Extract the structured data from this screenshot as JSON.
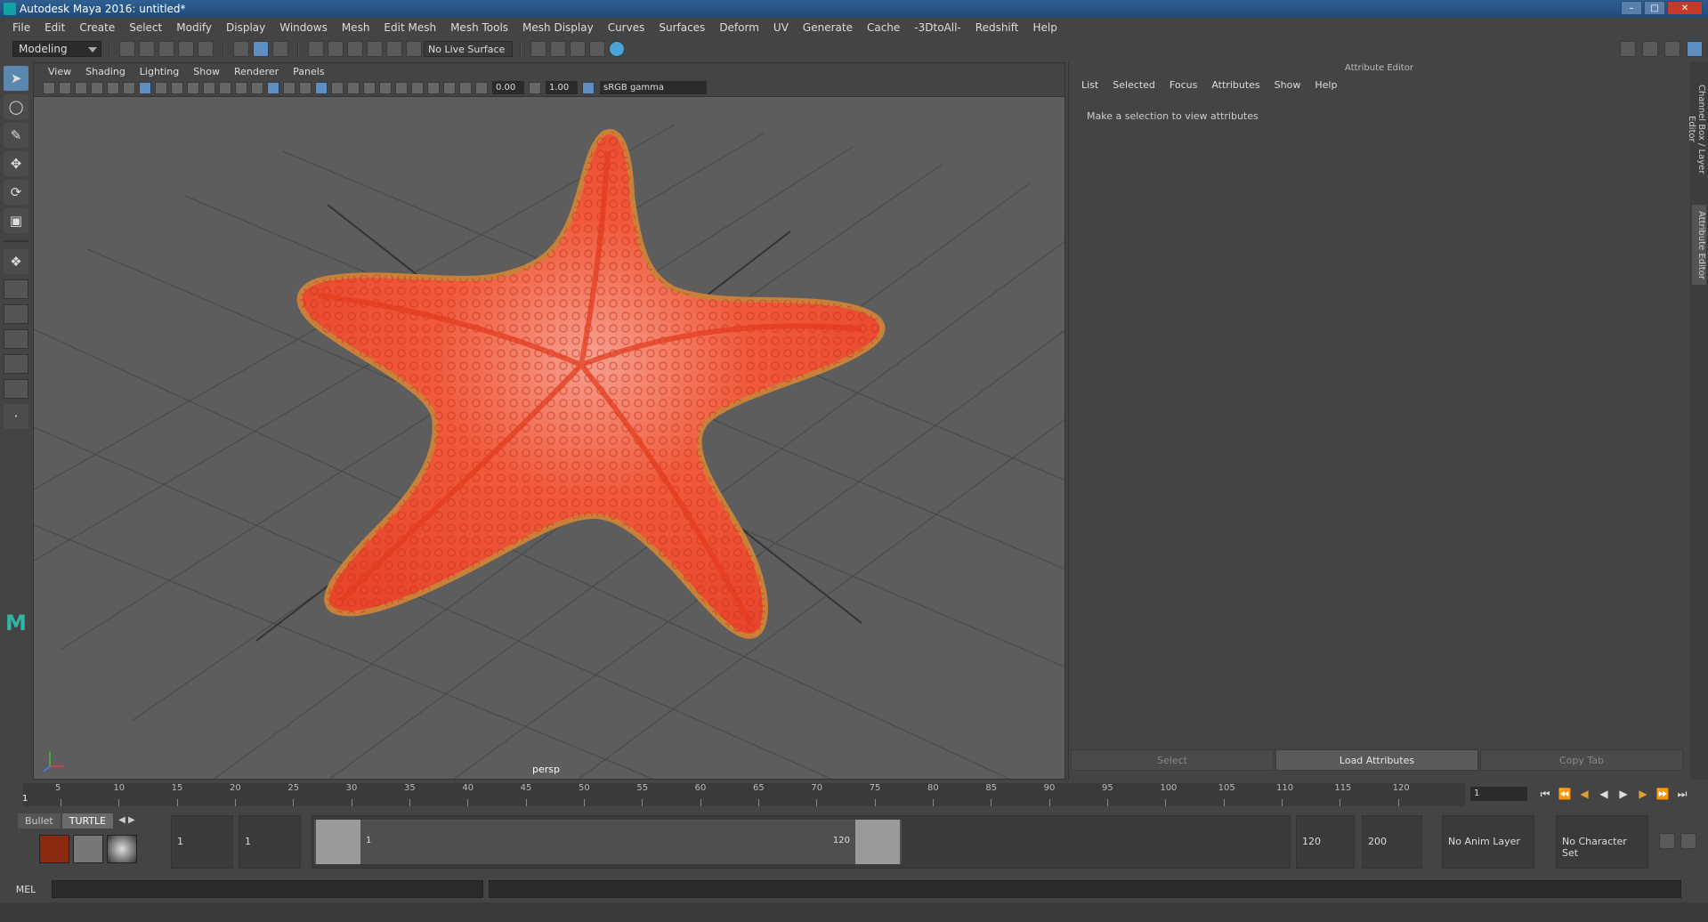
{
  "window": {
    "title": "Autodesk Maya 2016: untitled*"
  },
  "menus": [
    "File",
    "Edit",
    "Create",
    "Select",
    "Modify",
    "Display",
    "Windows",
    "Mesh",
    "Edit Mesh",
    "Mesh Tools",
    "Mesh Display",
    "Curves",
    "Surfaces",
    "Deform",
    "UV",
    "Generate",
    "Cache",
    "-3DtoAll-",
    "Redshift",
    "Help"
  ],
  "toolbar": {
    "mode": "Modeling",
    "live_surface": "No Live Surface"
  },
  "viewport": {
    "menus": [
      "View",
      "Shading",
      "Lighting",
      "Show",
      "Renderer",
      "Panels"
    ],
    "exposure": "0.00",
    "gamma": "1.00",
    "color_space": "sRGB gamma",
    "camera_label": "persp",
    "model_color": "#f04a2a"
  },
  "attribute_editor": {
    "title": "Attribute Editor",
    "menus": [
      "List",
      "Selected",
      "Focus",
      "Attributes",
      "Show",
      "Help"
    ],
    "message": "Make a selection to view attributes",
    "buttons": {
      "select": "Select",
      "load": "Load Attributes",
      "copy": "Copy Tab"
    }
  },
  "side_tabs": {
    "channel_box": "Channel Box / Layer Editor",
    "attribute_editor": "Attribute Editor"
  },
  "timeslider": {
    "ticks": [
      "5",
      "10",
      "15",
      "20",
      "25",
      "30",
      "35",
      "40",
      "45",
      "50",
      "55",
      "60",
      "65",
      "70",
      "75",
      "80",
      "85",
      "90",
      "95",
      "100",
      "105",
      "110",
      "115",
      "120"
    ],
    "current_frame": "1",
    "frame_field": "1"
  },
  "shelf": {
    "tabs": [
      "Bullet",
      "TURTLE"
    ]
  },
  "range": {
    "start": "1",
    "playback_start": "1",
    "range_start_label": "1",
    "range_end_label": "120",
    "playback_end": "120",
    "end": "200",
    "anim_layer": "No Anim Layer",
    "character_set": "No Character Set"
  },
  "command_line": {
    "label": "MEL"
  }
}
